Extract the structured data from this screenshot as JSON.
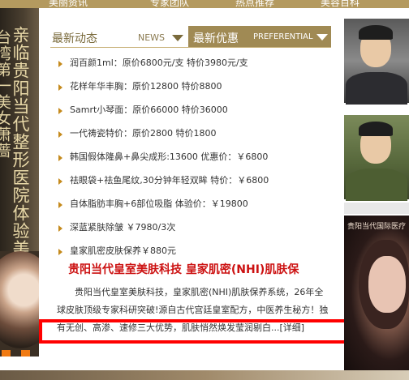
{
  "top_nav": {
    "items": [
      "美丽资讯",
      "专家团队",
      "热点推荐",
      "美容百科"
    ]
  },
  "left_banner": {
    "text_line1": "亲临贵阳当代整形医院体验美肤项目",
    "text_line2": "台湾第一美女萧蔷"
  },
  "tabs": {
    "news_title": "最新动态",
    "news_label_en": "NEWS",
    "preferential_title": "最新优惠",
    "preferential_label_en": "PREFERENTIAL"
  },
  "news_items": [
    "润百颜1ml：原价6800元/支 特价3980元/支",
    "花样年华丰胸：原价12800 特价8800",
    "Samrt小琴面：原价66000 特价36000",
    "一代祷瓷特价：原价2800 特价1800",
    "韩国假体隆鼻+鼻尖成形:13600 优惠价：￥6800",
    "祛眼袋+祛鱼尾纹,30分钟年轻双眸 特价：￥6800",
    "自体脂肪丰胸+6部位吸脂 体验价：￥19800",
    "深蓝紧肤除皱 ￥7980/3次",
    "皇家肌密皮肤保养￥880元"
  ],
  "article": {
    "headline": "贵阳当代皇室美肤科技 皇家肌密(NHI)肌肤保",
    "body": "贵阳当代皇室美肤科技，皇家肌密(NHI)肌肤保养系统，26年全球皮肤顶级专家科研突破!源自古代宫廷皇室配方，中医养生秘方！独有无创、高渗、速修三大优势，肌肤悄然焕发莹润剔白...[详细]"
  },
  "right_ad": {
    "caption": "贵阳当代国际医疗"
  },
  "colors": {
    "gold": "#a08a54",
    "headline_red": "#cc1111",
    "bullet_orange": "#c58a1c",
    "highlight_red": "#ff0000"
  }
}
